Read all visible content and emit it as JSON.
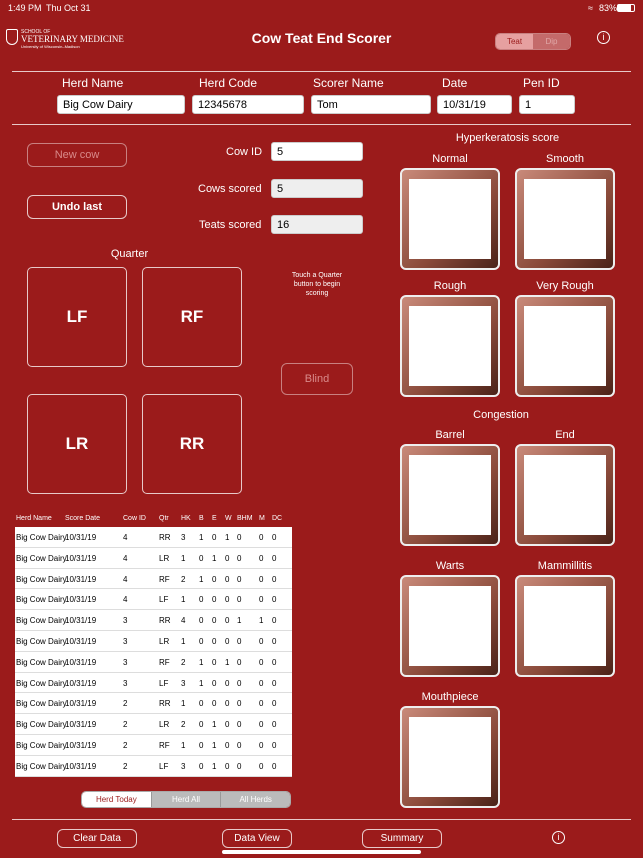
{
  "status": {
    "time": "1:49 PM",
    "date": "Thu Oct 31",
    "battery": "83%"
  },
  "logo": {
    "line1": "SCHOOL OF",
    "line2": "VETERINARY MEDICINE",
    "line3": "University of Wisconsin–Madison"
  },
  "title": "Cow Teat End Scorer",
  "mode_toggle": {
    "teat": "Teat",
    "dip": "Dip"
  },
  "herd": {
    "herd_name_label": "Herd Name",
    "herd_name": "Big Cow Dairy",
    "herd_code_label": "Herd Code",
    "herd_code": "12345678",
    "scorer_label": "Scorer Name",
    "scorer": "Tom",
    "date_label": "Date",
    "date": "10/31/19",
    "pen_label": "Pen ID",
    "pen": "1"
  },
  "controls": {
    "new_cow": "New cow",
    "undo_last": "Undo last",
    "cow_id_label": "Cow ID",
    "cow_id": "5",
    "cows_scored_label": "Cows scored",
    "cows_scored": "5",
    "teats_scored_label": "Teats scored",
    "teats_scored": "16",
    "quarter_label": "Quarter",
    "hint": "Touch a Quarter button to begin scoring",
    "blind": "Blind",
    "quarters": {
      "lf": "LF",
      "rf": "RF",
      "lr": "LR",
      "rr": "RR"
    }
  },
  "scores": {
    "hyper_title": "Hyperkeratosis score",
    "normal": "Normal",
    "smooth": "Smooth",
    "rough": "Rough",
    "very_rough": "Very Rough",
    "congestion_title": "Congestion",
    "barrel": "Barrel",
    "end": "End",
    "warts": "Warts",
    "mammillitis": "Mammillitis",
    "mouthpiece": "Mouthpiece"
  },
  "table": {
    "headers": [
      "Herd Name",
      "Score Date",
      "Cow ID",
      "Qtr",
      "HK",
      "B",
      "E",
      "W",
      "BHM",
      "M",
      "DC"
    ],
    "rows": [
      [
        "Big Cow Dairy",
        "10/31/19",
        "4",
        "RR",
        "3",
        "1",
        "0",
        "1",
        "0",
        "0",
        "0"
      ],
      [
        "Big Cow Dairy",
        "10/31/19",
        "4",
        "LR",
        "1",
        "0",
        "1",
        "0",
        "0",
        "0",
        "0"
      ],
      [
        "Big Cow Dairy",
        "10/31/19",
        "4",
        "RF",
        "2",
        "1",
        "0",
        "0",
        "0",
        "0",
        "0"
      ],
      [
        "Big Cow Dairy",
        "10/31/19",
        "4",
        "LF",
        "1",
        "0",
        "0",
        "0",
        "0",
        "0",
        "0"
      ],
      [
        "Big Cow Dairy",
        "10/31/19",
        "3",
        "RR",
        "4",
        "0",
        "0",
        "0",
        "1",
        "1",
        "0"
      ],
      [
        "Big Cow Dairy",
        "10/31/19",
        "3",
        "LR",
        "1",
        "0",
        "0",
        "0",
        "0",
        "0",
        "0"
      ],
      [
        "Big Cow Dairy",
        "10/31/19",
        "3",
        "RF",
        "2",
        "1",
        "0",
        "1",
        "0",
        "0",
        "0"
      ],
      [
        "Big Cow Dairy",
        "10/31/19",
        "3",
        "LF",
        "3",
        "1",
        "0",
        "0",
        "0",
        "0",
        "0"
      ],
      [
        "Big Cow Dairy",
        "10/31/19",
        "2",
        "RR",
        "1",
        "0",
        "0",
        "0",
        "0",
        "0",
        "0"
      ],
      [
        "Big Cow Dairy",
        "10/31/19",
        "2",
        "LR",
        "2",
        "0",
        "1",
        "0",
        "0",
        "0",
        "0"
      ],
      [
        "Big Cow Dairy",
        "10/31/19",
        "2",
        "RF",
        "1",
        "0",
        "1",
        "0",
        "0",
        "0",
        "0"
      ],
      [
        "Big Cow Dairy",
        "10/31/19",
        "2",
        "LF",
        "3",
        "0",
        "1",
        "0",
        "0",
        "0",
        "0"
      ]
    ]
  },
  "filter": {
    "herd_today": "Herd Today",
    "herd_all": "Herd All",
    "all_herds": "All Herds"
  },
  "bottom": {
    "clear": "Clear Data",
    "data_view": "Data View",
    "summary": "Summary"
  },
  "icons": {
    "info": "info-icon",
    "wifi": "wifi-icon",
    "battery": "battery-icon"
  }
}
